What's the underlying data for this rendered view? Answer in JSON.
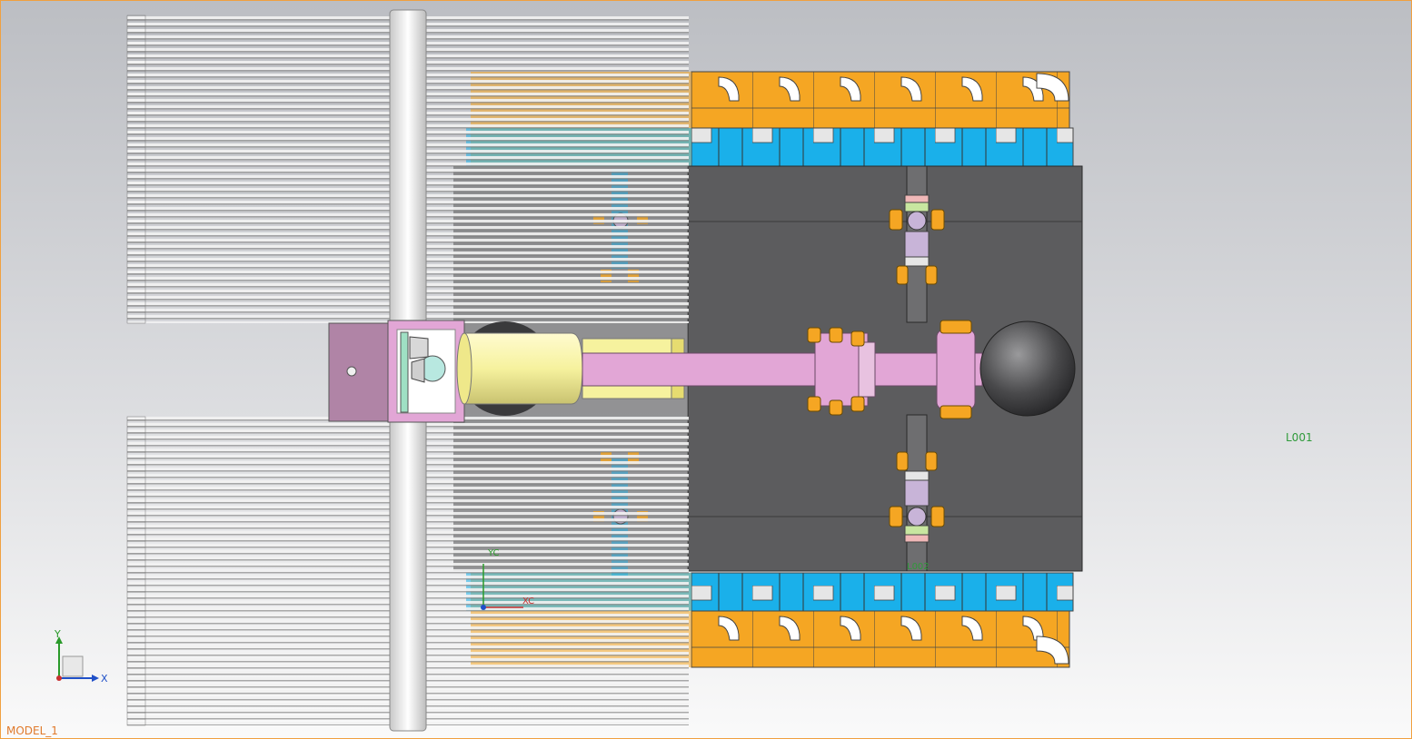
{
  "window": {
    "model_name": "MODEL_1"
  },
  "viewport": {
    "background_top": "#bcbec3",
    "background_bottom": "#fafafa",
    "border_color": "#f0a040",
    "annotations": {
      "l001": "L001",
      "l002": "L002"
    },
    "view_triad": {
      "x_label": "X",
      "y_label": "Y"
    },
    "wcs_triad": {
      "x_label": "XC",
      "y_label": "YC"
    }
  },
  "colors": {
    "track_orange": "#f5a623",
    "track_blue": "#1ab0ea",
    "chassis_gray": "#5c5c5e",
    "arm_pink": "#e2a6d6",
    "cylinder_yellow": "#f6f29e",
    "sphere_gray": "#4a4a4c",
    "annotation_green": "#2f9a3a",
    "model_label_orange": "#e07a2c"
  },
  "icons": [
    "view-triad-icon",
    "wcs-triad-icon"
  ]
}
